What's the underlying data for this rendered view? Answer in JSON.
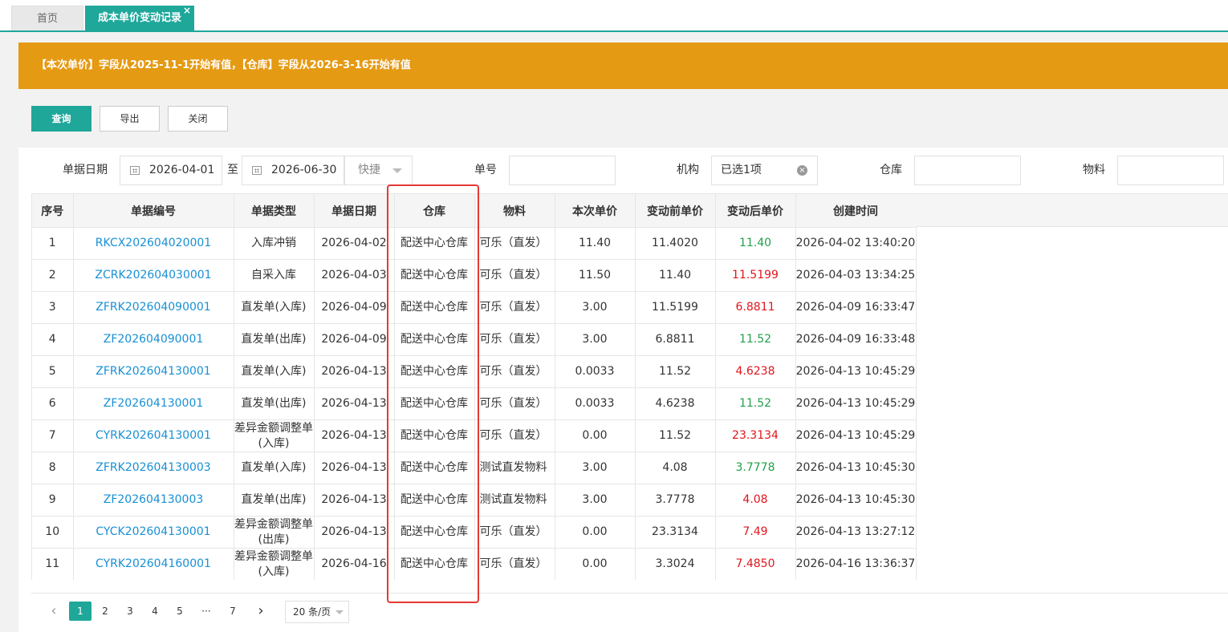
{
  "tabs": [
    {
      "label": "首页"
    },
    {
      "label": "成本单价变动记录",
      "close": "×"
    }
  ],
  "notice": "【本次单价】字段从2025-11-1开始有值，【仓库】字段从2026-3-16开始有值",
  "toolbar": {
    "query": "查询",
    "export": "导出",
    "close": "关闭"
  },
  "filters": {
    "date_label": "单据日期",
    "date_from": "2026-04-01",
    "date_sep": "至",
    "date_to": "2026-06-30",
    "quick": "快捷",
    "docno_label": "单号",
    "org_label": "机构",
    "org_value": "已选1项",
    "warehouse_label": "仓库",
    "material_label": "物料"
  },
  "table": {
    "headers": [
      "序号",
      "单据编号",
      "单据类型",
      "单据日期",
      "仓库",
      "物料",
      "本次单价",
      "变动前单价",
      "变动后单价",
      "创建时间"
    ],
    "rows": [
      {
        "no": "1",
        "code": "RKCX202604020001",
        "type": "入库冲销",
        "date": "2026-04-02",
        "wh": "配送中心仓库",
        "mat": "可乐（直发）",
        "price": "11.40",
        "before": "11.4020",
        "after": "11.40",
        "trend": "up",
        "created": "2026-04-02 13:40:20"
      },
      {
        "no": "2",
        "code": "ZCRK202604030001",
        "type": "自采入库",
        "date": "2026-04-03",
        "wh": "配送中心仓库",
        "mat": "可乐（直发）",
        "price": "11.50",
        "before": "11.40",
        "after": "11.5199",
        "trend": "down",
        "created": "2026-04-03 13:34:25"
      },
      {
        "no": "3",
        "code": "ZFRK202604090001",
        "type": "直发单(入库)",
        "date": "2026-04-09",
        "wh": "配送中心仓库",
        "mat": "可乐（直发）",
        "price": "3.00",
        "before": "11.5199",
        "after": "6.8811",
        "trend": "down",
        "created": "2026-04-09 16:33:47"
      },
      {
        "no": "4",
        "code": "ZF202604090001",
        "type": "直发单(出库)",
        "date": "2026-04-09",
        "wh": "配送中心仓库",
        "mat": "可乐（直发）",
        "price": "3.00",
        "before": "6.8811",
        "after": "11.52",
        "trend": "up",
        "created": "2026-04-09 16:33:48"
      },
      {
        "no": "5",
        "code": "ZFRK202604130001",
        "type": "直发单(入库)",
        "date": "2026-04-13",
        "wh": "配送中心仓库",
        "mat": "可乐（直发）",
        "price": "0.0033",
        "before": "11.52",
        "after": "4.6238",
        "trend": "down",
        "created": "2026-04-13 10:45:29"
      },
      {
        "no": "6",
        "code": "ZF202604130001",
        "type": "直发单(出库)",
        "date": "2026-04-13",
        "wh": "配送中心仓库",
        "mat": "可乐（直发）",
        "price": "0.0033",
        "before": "4.6238",
        "after": "11.52",
        "trend": "up",
        "created": "2026-04-13 10:45:29"
      },
      {
        "no": "7",
        "code": "CYRK202604130001",
        "type": "差异金额调整单(入库)",
        "date": "2026-04-13",
        "wh": "配送中心仓库",
        "mat": "可乐（直发）",
        "price": "0.00",
        "before": "11.52",
        "after": "23.3134",
        "trend": "down",
        "created": "2026-04-13 10:45:29"
      },
      {
        "no": "8",
        "code": "ZFRK202604130003",
        "type": "直发单(入库)",
        "date": "2026-04-13",
        "wh": "配送中心仓库",
        "mat": "测试直发物料",
        "price": "3.00",
        "before": "4.08",
        "after": "3.7778",
        "trend": "up",
        "created": "2026-04-13 10:45:30"
      },
      {
        "no": "9",
        "code": "ZF202604130003",
        "type": "直发单(出库)",
        "date": "2026-04-13",
        "wh": "配送中心仓库",
        "mat": "测试直发物料",
        "price": "3.00",
        "before": "3.7778",
        "after": "4.08",
        "trend": "down",
        "created": "2026-04-13 10:45:30"
      },
      {
        "no": "10",
        "code": "CYCK202604130001",
        "type": "差异金额调整单(出库)",
        "date": "2026-04-13",
        "wh": "配送中心仓库",
        "mat": "可乐（直发）",
        "price": "0.00",
        "before": "23.3134",
        "after": "7.49",
        "trend": "down",
        "created": "2026-04-13 13:27:12"
      },
      {
        "no": "11",
        "code": "CYRK202604160001",
        "type": "差异金额调整单(入库)",
        "date": "2026-04-16",
        "wh": "配送中心仓库",
        "mat": "可乐（直发）",
        "price": "0.00",
        "before": "3.3024",
        "after": "7.4850",
        "trend": "down",
        "created": "2026-04-16 13:36:37"
      }
    ]
  },
  "pagination": {
    "prev": "‹",
    "pages": [
      "1",
      "2",
      "3",
      "4",
      "5",
      "···",
      "7"
    ],
    "next": "›",
    "active": "1",
    "page_size": "20 条/页"
  },
  "colors": {
    "accent": "#1fa79a",
    "notice": "#e59a13",
    "link": "#1890d5",
    "up": "#22a04b",
    "down": "#e0161d",
    "highlight": "#e53935"
  }
}
